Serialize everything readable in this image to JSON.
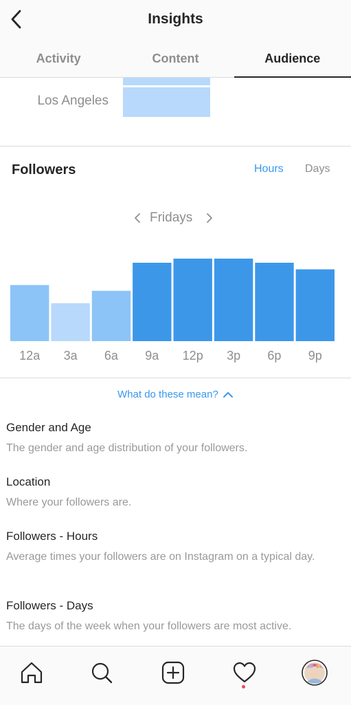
{
  "header": {
    "title": "Insights"
  },
  "tabs": [
    {
      "label": "Activity",
      "active": false
    },
    {
      "label": "Content",
      "active": false
    },
    {
      "label": "Audience",
      "active": true
    }
  ],
  "location": {
    "city_label": "Los Angeles"
  },
  "followers": {
    "title": "Followers",
    "toggle_hours": "Hours",
    "toggle_days": "Days",
    "day": "Fridays"
  },
  "chart_data": {
    "type": "bar",
    "categories": [
      "12a",
      "3a",
      "6a",
      "9a",
      "12p",
      "3p",
      "6p",
      "9p"
    ],
    "values": [
      0.68,
      0.46,
      0.61,
      0.95,
      1.0,
      1.0,
      0.95,
      0.87
    ],
    "ylim": [
      0,
      1
    ],
    "grid": false,
    "colors": [
      "#8cc4f7",
      "#b8d9fb",
      "#8cc4f7",
      "#3d97e9",
      "#3d97e9",
      "#3d97e9",
      "#3d97e9",
      "#3d97e9"
    ]
  },
  "definitions": {
    "toggle_label": "What do these mean?",
    "items": [
      {
        "title": "Gender and Age",
        "desc": "The gender and age distribution of your followers."
      },
      {
        "title": "Location",
        "desc": "Where your followers are."
      },
      {
        "title": "Followers - Hours",
        "desc": "Average times your followers are on Instagram on a typical day."
      },
      {
        "title": "Followers - Days",
        "desc": "The days of the week when your followers are most active."
      }
    ]
  },
  "nav": {
    "items": [
      "home-icon",
      "search-icon",
      "new-post-icon",
      "activity-heart-icon",
      "profile-avatar"
    ]
  },
  "colors": {
    "accent": "#3897f0",
    "bar_dark": "#3d97e9",
    "bar_light": "#8cc4f7",
    "bar_lighter": "#b8d9fb",
    "notification": "#ed4956"
  }
}
